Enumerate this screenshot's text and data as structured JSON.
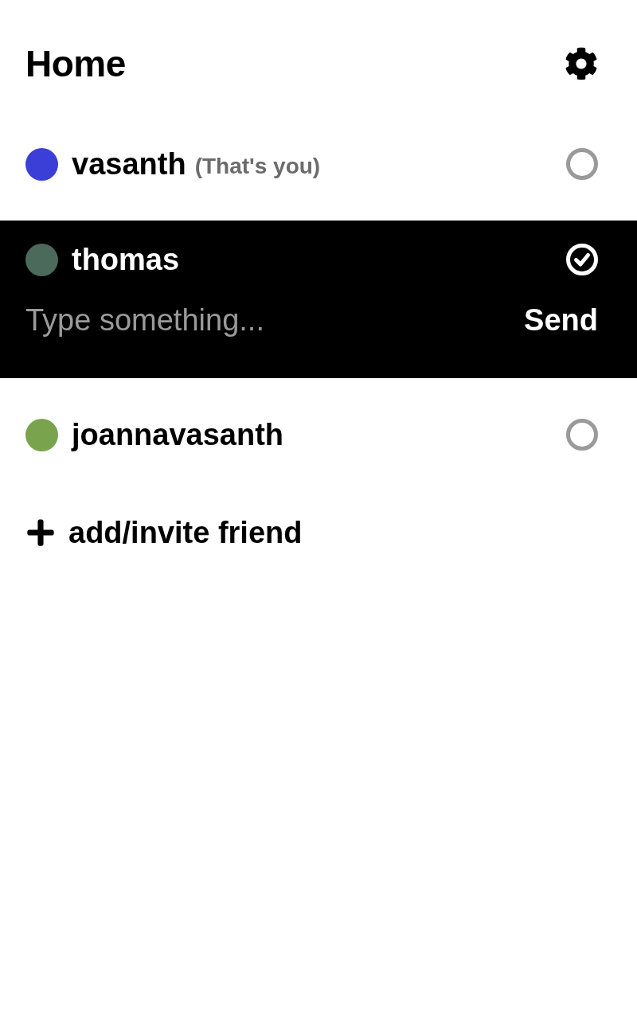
{
  "header": {
    "title": "Home"
  },
  "friends": [
    {
      "name": "vasanth",
      "note": "(That's you)",
      "color": "#3b3fd8",
      "selected": false
    },
    {
      "name": "thomas",
      "color": "#4b6a5b",
      "selected": true
    },
    {
      "name": "joannavasanth",
      "color": "#7aa34e",
      "selected": false
    }
  ],
  "composer": {
    "placeholder": "Type something...",
    "send_label": "Send"
  },
  "add_friend": {
    "label": "add/invite friend"
  }
}
